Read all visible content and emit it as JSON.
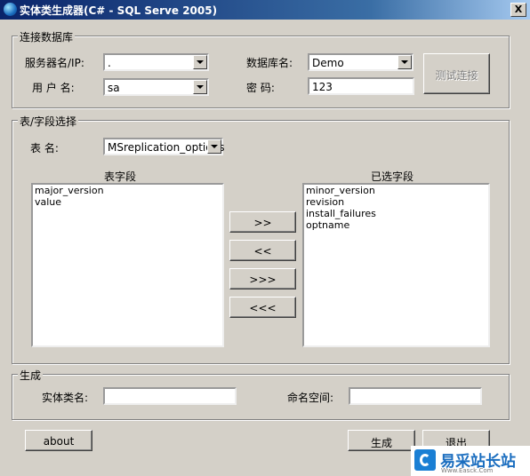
{
  "window": {
    "title": "实体类生成器(C# - SQL Serve 2005)",
    "close_label": "X"
  },
  "connection": {
    "legend": "连接数据库",
    "server_label": "服务器名/IP:",
    "server_value": ".",
    "database_label": "数据库名:",
    "database_value": "Demo",
    "user_label": "用 户 名:",
    "user_value": "sa",
    "password_label": "密  码:",
    "password_value": "123",
    "test_button": "测试连接"
  },
  "fields": {
    "legend": "表/字段选择",
    "table_label": "表  名:",
    "table_value": "MSreplication_options",
    "table_fields_header": "表字段",
    "selected_fields_header": "已选字段",
    "table_fields": [
      "major_version",
      "value"
    ],
    "selected_fields": [
      "minor_version",
      "revision",
      "install_failures",
      "optname"
    ],
    "move_right": ">>",
    "move_left": "<<",
    "move_all_right": ">>>",
    "move_all_left": "<<<"
  },
  "generate": {
    "legend": "生成",
    "class_label": "实体类名:",
    "class_value": "",
    "namespace_label": "命名空间:",
    "namespace_value": ""
  },
  "buttons": {
    "about": "about",
    "generate": "生成",
    "exit": "退出"
  },
  "watermark": {
    "text": "易采站长站",
    "sub": "Www.Easck.Com"
  }
}
